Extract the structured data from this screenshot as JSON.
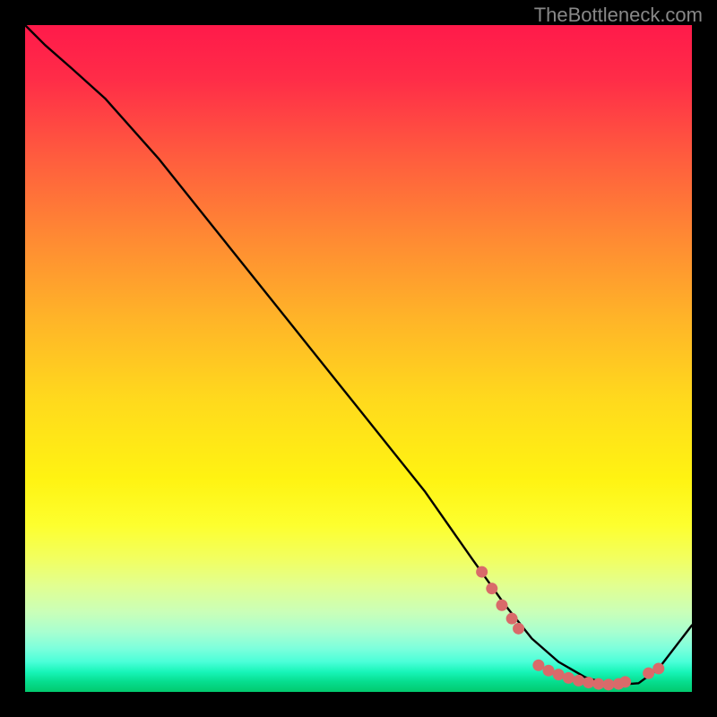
{
  "attribution": "TheBottleneck.com",
  "chart_data": {
    "type": "line",
    "title": "",
    "xlabel": "",
    "ylabel": "",
    "xlim": [
      0,
      100
    ],
    "ylim": [
      0,
      100
    ],
    "series": [
      {
        "name": "bottleneck-curve",
        "x": [
          0,
          3,
          7,
          12,
          20,
          30,
          40,
          50,
          60,
          67,
          72,
          76,
          80,
          84,
          88,
          92,
          95,
          100
        ],
        "y": [
          100,
          97,
          93.5,
          89,
          80,
          67.5,
          55,
          42.5,
          30,
          20,
          13,
          8,
          4.5,
          2.2,
          1.0,
          1.3,
          3.5,
          10
        ]
      }
    ],
    "markers": [
      {
        "x": 68.5,
        "y": 18.0
      },
      {
        "x": 70.0,
        "y": 15.5
      },
      {
        "x": 71.5,
        "y": 13.0
      },
      {
        "x": 73.0,
        "y": 11.0
      },
      {
        "x": 74.0,
        "y": 9.5
      },
      {
        "x": 77.0,
        "y": 4.0
      },
      {
        "x": 78.5,
        "y": 3.2
      },
      {
        "x": 80.0,
        "y": 2.6
      },
      {
        "x": 81.5,
        "y": 2.1
      },
      {
        "x": 83.0,
        "y": 1.7
      },
      {
        "x": 84.5,
        "y": 1.4
      },
      {
        "x": 86.0,
        "y": 1.2
      },
      {
        "x": 87.5,
        "y": 1.1
      },
      {
        "x": 89.0,
        "y": 1.2
      },
      {
        "x": 90.0,
        "y": 1.5
      },
      {
        "x": 93.5,
        "y": 2.8
      },
      {
        "x": 95.0,
        "y": 3.5
      }
    ],
    "colors": {
      "curve": "#000000",
      "marker": "#d96a6a"
    }
  }
}
